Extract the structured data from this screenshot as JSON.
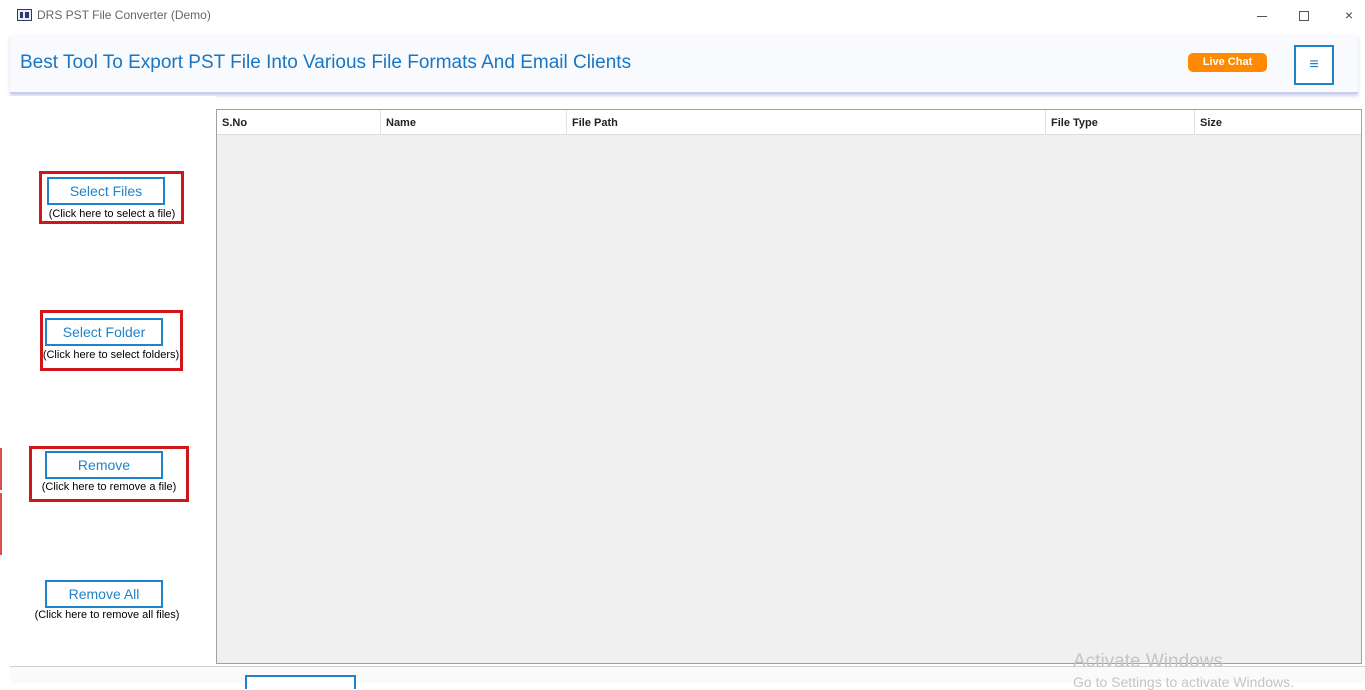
{
  "window": {
    "title": "DRS PST File Converter (Demo)",
    "controls": {
      "minimize": "minimize-icon",
      "maximize": "maximize-icon",
      "close": "×"
    }
  },
  "header": {
    "title": "Best Tool To Export PST File Into Various File Formats And Email Clients",
    "live_chat_label": "Live Chat",
    "menu_glyph": "≡"
  },
  "actions": {
    "select_files": {
      "label": "Select Files",
      "hint": "(Click here to select a file)"
    },
    "select_folder": {
      "label": "Select Folder",
      "hint": "(Click here to select folders)"
    },
    "remove": {
      "label": "Remove",
      "hint": "(Click here to remove a file)"
    },
    "remove_all": {
      "label": "Remove All",
      "hint": "(Click here to remove all files)"
    }
  },
  "table": {
    "columns": [
      "S.No",
      "Name",
      "File Path",
      "File Type",
      "Size"
    ],
    "rows": []
  },
  "watermark": {
    "line1": "Activate Windows",
    "line2": "Go to Settings to activate Windows."
  },
  "colors": {
    "accent": "#1f83c9",
    "header_title": "#1976c4",
    "live_chat": "#ff8a00",
    "highlight_frame": "#d0161a"
  }
}
